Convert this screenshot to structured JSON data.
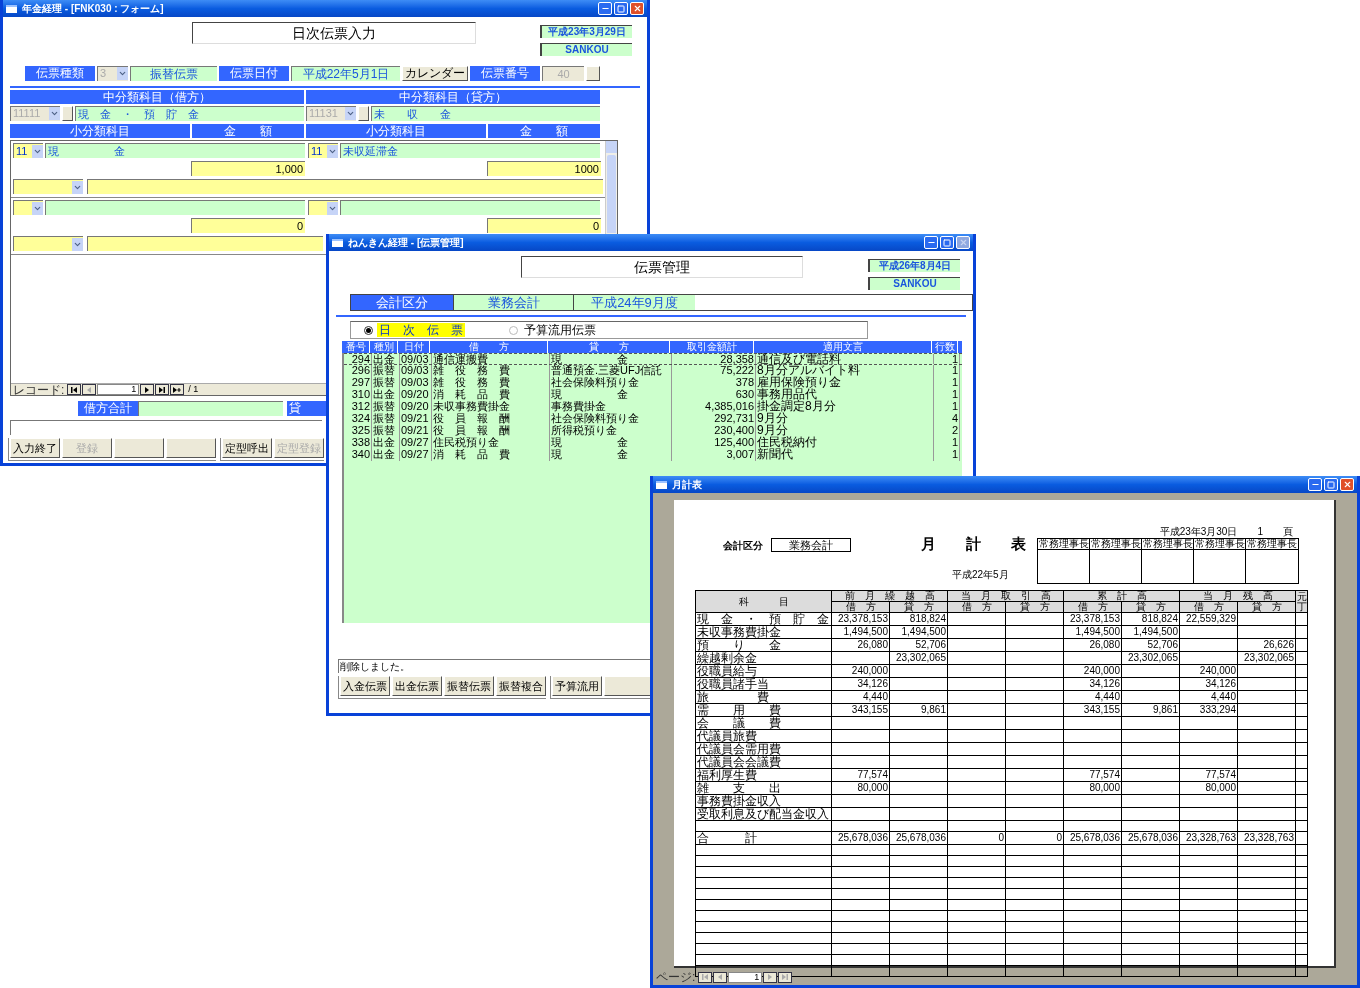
{
  "entry_window": {
    "title": "年金経理 - [FNK030 : フォーム]",
    "close_enabled": true,
    "form_title": "日次伝票入力",
    "date": "平成23年3月29日",
    "user": "SANKOU",
    "header_fields": [
      {
        "kind": "label",
        "text": "伝票種類"
      },
      {
        "kind": "combo",
        "value": "3",
        "disabled": true
      },
      {
        "kind": "field",
        "value": "振替伝票"
      },
      {
        "kind": "label",
        "text": "伝票日付"
      },
      {
        "kind": "field",
        "value": "平成22年5月1日"
      },
      {
        "kind": "button",
        "text": "カレンダー"
      },
      {
        "kind": "label",
        "text": "伝票番号"
      },
      {
        "kind": "number",
        "value": "40",
        "disabled": true
      },
      {
        "kind": "blank_button"
      }
    ],
    "sides": [
      {
        "heading": "中分類科目（借方）",
        "code": "11111",
        "code_disabled": true,
        "account": "現　金　・　預　貯　金",
        "sub_heading": "小分類科目",
        "amount_heading": "金　　額"
      },
      {
        "heading": "中分類科目（貸方）",
        "code": "11131",
        "code_disabled": true,
        "account": "未　　収　　金",
        "sub_heading": "小分類科目",
        "amount_heading": "金　　額"
      }
    ],
    "records": [
      {
        "debit_code": "11",
        "debit_account": "現　　　　　金",
        "debit_amount": "1,000",
        "credit_code": "11",
        "credit_account": "未収延滞金",
        "credit_amount": "1000"
      },
      {
        "debit_amount": "0",
        "credit_amount": "0"
      }
    ],
    "record_nav": {
      "label": "レコード:",
      "current": "1",
      "total": "/ 1"
    },
    "totals": {
      "debit_label": "借方合計",
      "credit_label": "貸"
    },
    "button_groups": [
      [
        {
          "kind": "button",
          "text": "入力終了",
          "disabled": false
        },
        {
          "kind": "button",
          "text": "登録",
          "disabled": true
        },
        {
          "kind": "blank"
        },
        {
          "kind": "blank"
        }
      ],
      [
        {
          "kind": "button",
          "text": "定型呼出",
          "disabled": false
        },
        {
          "kind": "button",
          "text": "定型登録",
          "disabled": true
        }
      ]
    ]
  },
  "list_window": {
    "title": "ねんきん経理 - [伝票管理]",
    "close_enabled": false,
    "form_title": "伝票管理",
    "date": "平成26年8月4日",
    "user": "SANKOU",
    "section_label": "会計区分",
    "section_value": "業務会計",
    "period": "平成24年9月度",
    "radios": [
      {
        "label": "日　次　伝　票",
        "selected": true
      },
      {
        "label": "予算流用伝票",
        "selected": false
      }
    ],
    "columns": [
      "番号",
      "種別",
      "日付",
      "借　　方",
      "貸　　方",
      "取引金額計",
      "適用文言",
      "行数"
    ],
    "rows": [
      {
        "cells": [
          "294",
          "出金",
          "09/03",
          "通信運搬費",
          "現　　　　　金",
          "28,358",
          "通信及び電話料",
          "1"
        ],
        "selected": true
      },
      {
        "cells": [
          "296",
          "振替",
          "09/03",
          "雑　役　務　費",
          "普通預金.三菱UFJ信託",
          "75,222",
          "8月分アルバイト料",
          "1"
        ],
        "selected": false
      },
      {
        "cells": [
          "297",
          "振替",
          "09/03",
          "雑　役　務　費",
          "社会保険料預り金",
          "378",
          "雇用保険預り金",
          "1"
        ],
        "selected": false
      },
      {
        "cells": [
          "310",
          "出金",
          "09/20",
          "消　耗　品　費",
          "現　　　　　金",
          "630",
          "事務用品代",
          "1"
        ],
        "selected": false
      },
      {
        "cells": [
          "312",
          "振替",
          "09/20",
          "未収事務費掛金",
          "事務費掛金",
          "4,385,016",
          "掛金調定8月分",
          "1"
        ],
        "selected": false
      },
      {
        "cells": [
          "324",
          "振替",
          "09/21",
          "役　員　報　酬",
          "社会保険料預り金",
          "292,731",
          "9月分",
          "4"
        ],
        "selected": false
      },
      {
        "cells": [
          "325",
          "振替",
          "09/21",
          "役　員　報　酬",
          "所得税預り金",
          "230,400",
          "9月分",
          "2"
        ],
        "selected": false
      },
      {
        "cells": [
          "338",
          "出金",
          "09/27",
          "住民税預り金",
          "現　　　　　金",
          "125,400",
          "住民税納付",
          "1"
        ],
        "selected": false
      },
      {
        "cells": [
          "340",
          "出金",
          "09/27",
          "消　耗　品　費",
          "現　　　　　金",
          "3,007",
          "新聞代",
          "1"
        ],
        "selected": false
      }
    ],
    "message": "削除しました。",
    "button_groups": [
      [
        {
          "kind": "button",
          "text": "入金伝票",
          "disabled": false
        },
        {
          "kind": "button",
          "text": "出金伝票",
          "disabled": false
        },
        {
          "kind": "button",
          "text": "振替伝票",
          "disabled": false
        },
        {
          "kind": "button",
          "text": "振替複合",
          "disabled": false
        }
      ],
      [
        {
          "kind": "button",
          "text": "予算流用",
          "disabled": false
        },
        {
          "kind": "blank"
        }
      ]
    ]
  },
  "report_window": {
    "title": "月計表",
    "close_enabled": true,
    "section_label": "会計区分",
    "section_value": "業務会計",
    "report_title": "月　　計　　表",
    "period": "平成22年5月",
    "print_date": "平成23年3月30日",
    "page": "1",
    "page_unit": "頁",
    "approvers": [
      "常務理事長",
      "常務理事長",
      "常務理事長",
      "常務理事長",
      "常務理事長"
    ],
    "subject_heading": "科　　　目",
    "ledger_heading": "元丁",
    "group_columns": [
      "前　月　繰　越　高",
      "当　月　取　引　高",
      "累　計　高",
      "当　月　残　高"
    ],
    "sub_columns": [
      "借　方",
      "貸　方",
      "借　方",
      "貸　方",
      "借　方",
      "貸　方",
      "借　方",
      "貸　方"
    ],
    "rows": [
      {
        "label": "現　金　・　預　貯　金",
        "prev_debit": "23,378,153",
        "prev_credit": "818,824",
        "cum_debit": "23,378,153",
        "cum_credit": "818,824",
        "bal_debit": "22,559,329"
      },
      {
        "label": "未収事務費掛金",
        "prev_debit": "1,494,500",
        "prev_credit": "1,494,500",
        "cum_debit": "1,494,500",
        "cum_credit": "1,494,500"
      },
      {
        "label": "預　　り　　金",
        "prev_debit": "26,080",
        "prev_credit": "52,706",
        "cum_debit": "26,080",
        "cum_credit": "52,706",
        "bal_credit": "26,626"
      },
      {
        "label": "繰越剰余金",
        "prev_credit": "23,302,065",
        "cum_credit": "23,302,065",
        "bal_credit": "23,302,065"
      },
      {
        "label": "役職員給与",
        "prev_debit": "240,000",
        "cum_debit": "240,000",
        "bal_debit": "240,000"
      },
      {
        "label": "役職員諸手当",
        "prev_debit": "34,126",
        "cum_debit": "34,126",
        "bal_debit": "34,126"
      },
      {
        "label": "旅　　　　費",
        "prev_debit": "4,440",
        "cum_debit": "4,440",
        "bal_debit": "4,440"
      },
      {
        "label": "需　　用　　費",
        "prev_debit": "343,155",
        "prev_credit": "9,861",
        "cum_debit": "343,155",
        "cum_credit": "9,861",
        "bal_debit": "333,294"
      },
      {
        "label": "会　　議　　費"
      },
      {
        "label": "代議員旅費"
      },
      {
        "label": "代議員会需用費"
      },
      {
        "label": "代議員会会議費"
      },
      {
        "label": "福利厚生費",
        "prev_debit": "77,574",
        "cum_debit": "77,574",
        "bal_debit": "77,574"
      },
      {
        "label": "雑　　支　　出",
        "prev_debit": "80,000",
        "cum_debit": "80,000",
        "bal_debit": "80,000"
      },
      {
        "label": "事務費掛金収入"
      },
      {
        "label": "受取利息及び配当金収入"
      }
    ],
    "total": {
      "label": "合　　　計",
      "prev_debit": "25,678,036",
      "prev_credit": "25,678,036",
      "month_debit": "0",
      "month_credit": "0",
      "cum_debit": "25,678,036",
      "cum_credit": "25,678,036",
      "bal_debit": "23,328,763",
      "bal_credit": "23,328,763"
    },
    "page_nav": {
      "label": "ページ:",
      "current": "1"
    }
  }
}
